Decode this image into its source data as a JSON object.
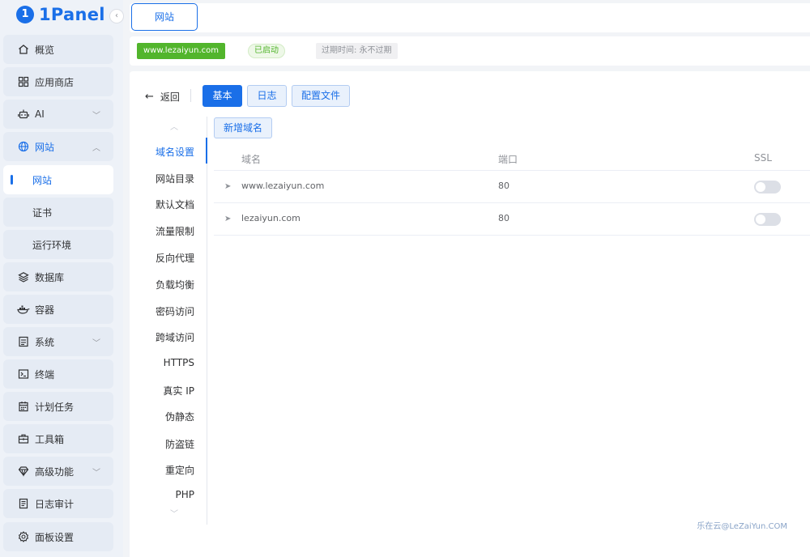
{
  "app": {
    "logo_text": "1Panel",
    "collapse_glyph": "‹"
  },
  "sidebar": {
    "items": [
      {
        "label": "概览",
        "icon": "home-icon"
      },
      {
        "label": "应用商店",
        "icon": "grid-icon"
      },
      {
        "label": "AI",
        "icon": "robot-icon",
        "chevron": "﹀"
      },
      {
        "label": "网站",
        "icon": "globe-icon",
        "chevron": "︿"
      },
      {
        "label": "网站",
        "sub": true,
        "active": true
      },
      {
        "label": "证书",
        "sub": true
      },
      {
        "label": "运行环境",
        "sub": true
      },
      {
        "label": "数据库",
        "icon": "layers-icon"
      },
      {
        "label": "容器",
        "icon": "docker-icon"
      },
      {
        "label": "系统",
        "icon": "system-icon",
        "chevron": "﹀"
      },
      {
        "label": "终端",
        "icon": "terminal-icon"
      },
      {
        "label": "计划任务",
        "icon": "calendar-icon"
      },
      {
        "label": "工具箱",
        "icon": "toolbox-icon"
      },
      {
        "label": "高级功能",
        "icon": "diamond-icon",
        "chevron": "﹀"
      },
      {
        "label": "日志审计",
        "icon": "log-icon"
      },
      {
        "label": "面板设置",
        "icon": "settings-icon"
      }
    ]
  },
  "tabbar": {
    "tab_label": "网站"
  },
  "infobar": {
    "domain": "www.lezaiyun.com",
    "status": "已启动",
    "expire": "过期时间: 永不过期"
  },
  "toolbar": {
    "back_label": "返回",
    "back_glyph": "←",
    "tabs": [
      "基本",
      "日志",
      "配置文件"
    ]
  },
  "subnav": {
    "up_glyph": "︿",
    "down_glyph": "﹀",
    "items": [
      "域名设置",
      "网站目录",
      "默认文档",
      "流量限制",
      "反向代理",
      "负载均衡",
      "密码访问",
      "跨域访问",
      "HTTPS",
      "真实 IP",
      "伪静态",
      "防盗链",
      "重定向",
      "PHP"
    ],
    "active_index": 0
  },
  "content": {
    "add_domain_label": "新增域名",
    "columns": [
      "域名",
      "端口",
      "SSL"
    ],
    "row_glyph": "➤",
    "rows": [
      {
        "domain": "www.lezaiyun.com",
        "port": "80",
        "ssl": false
      },
      {
        "domain": "lezaiyun.com",
        "port": "80",
        "ssl": false
      }
    ]
  },
  "watermark": "乐在云@LeZaiYun.COM",
  "colors": {
    "accent": "#1a6fe8",
    "success": "#52b52c"
  }
}
